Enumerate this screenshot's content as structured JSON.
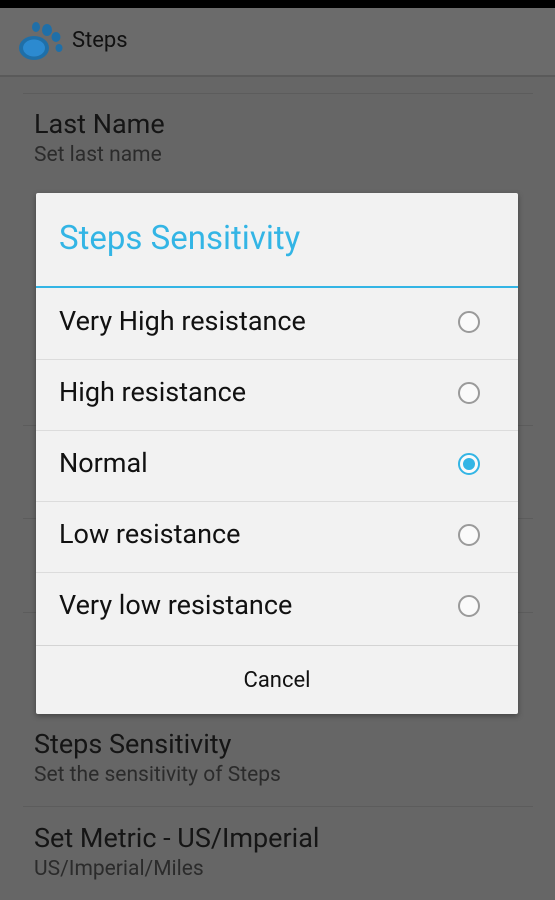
{
  "action_bar": {
    "title": "Steps",
    "icon": "paw-icon"
  },
  "settings": {
    "items": [
      {
        "title": "Last Name",
        "summary": "Set last name"
      },
      {
        "title": "Steps Sensitivity",
        "summary": "Set the sensitivity of Steps"
      },
      {
        "title": "Set Metric - US/Imperial",
        "summary": "US/Imperial/Miles"
      }
    ]
  },
  "dialog": {
    "title": "Steps Sensitivity",
    "options": [
      {
        "label": "Very High resistance",
        "checked": false
      },
      {
        "label": "High resistance",
        "checked": false
      },
      {
        "label": "Normal",
        "checked": true
      },
      {
        "label": "Low resistance",
        "checked": false
      },
      {
        "label": "Very low resistance",
        "checked": false
      }
    ],
    "cancel_label": "Cancel"
  },
  "colors": {
    "accent": "#33b5e5",
    "scrim_background": "#666666",
    "dialog_background": "#f2f2f2"
  }
}
